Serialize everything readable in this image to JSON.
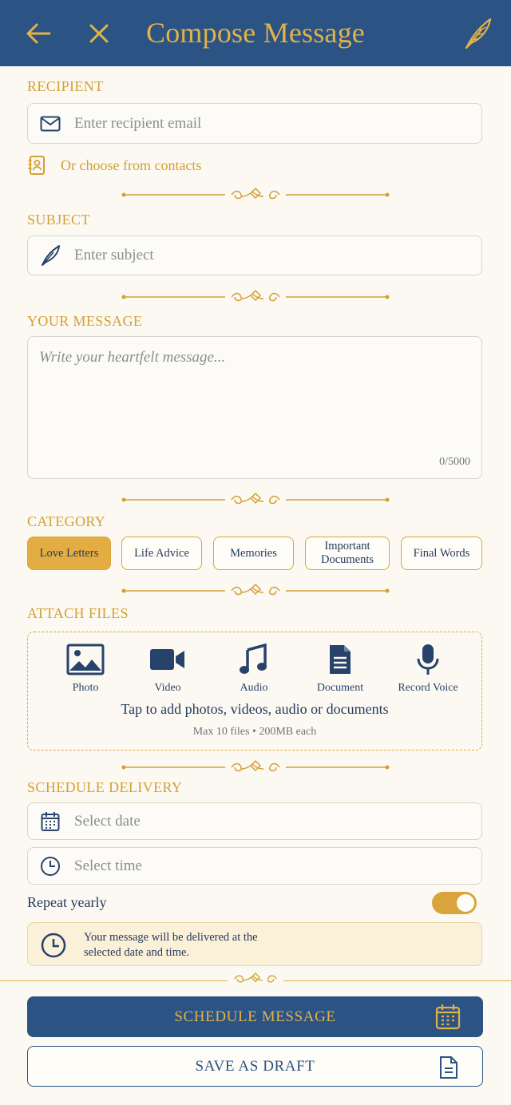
{
  "header": {
    "title": "Compose Message",
    "back_icon": "arrow-left-icon",
    "close_icon": "close-icon",
    "quill_icon": "quill-icon"
  },
  "recipient": {
    "label": "RECIPIENT",
    "placeholder": "Enter recipient email",
    "contacts_link": "Or choose from contacts"
  },
  "subject": {
    "label": "SUBJECT",
    "placeholder": "Enter subject"
  },
  "message": {
    "label": "YOUR MESSAGE",
    "placeholder": "Write your heartfelt message...",
    "counter": "0/5000"
  },
  "category": {
    "label": "CATEGORY",
    "chips": [
      {
        "label": "Love Letters",
        "active": true
      },
      {
        "label": "Life Advice",
        "active": false
      },
      {
        "label": "Memories",
        "active": false
      },
      {
        "label": "Important Documents",
        "active": false
      },
      {
        "label": "Final Words",
        "active": false
      }
    ]
  },
  "attach": {
    "label": "ATTACH FILES",
    "types": [
      {
        "label": "Photo",
        "icon": "image-icon"
      },
      {
        "label": "Video",
        "icon": "video-camera-icon"
      },
      {
        "label": "Audio",
        "icon": "music-note-icon"
      },
      {
        "label": "Document",
        "icon": "document-icon"
      },
      {
        "label": "Record Voice",
        "icon": "microphone-icon"
      }
    ],
    "hint": "Tap to add photos, videos, audio or documents",
    "limit": "Max 10 files • 200MB each"
  },
  "schedule": {
    "label": "SCHEDULE DELIVERY",
    "date_placeholder": "Select date",
    "time_placeholder": "Select time",
    "repeat_label": "Repeat yearly",
    "repeat_on": true,
    "info": "Your message will be delivered at the selected date and time."
  },
  "actions": {
    "schedule_label": "SCHEDULE MESSAGE",
    "draft_label": "SAVE AS DRAFT"
  },
  "colors": {
    "navy": "#2b5485",
    "gold": "#e2b247",
    "cream": "#fcf9f2"
  }
}
